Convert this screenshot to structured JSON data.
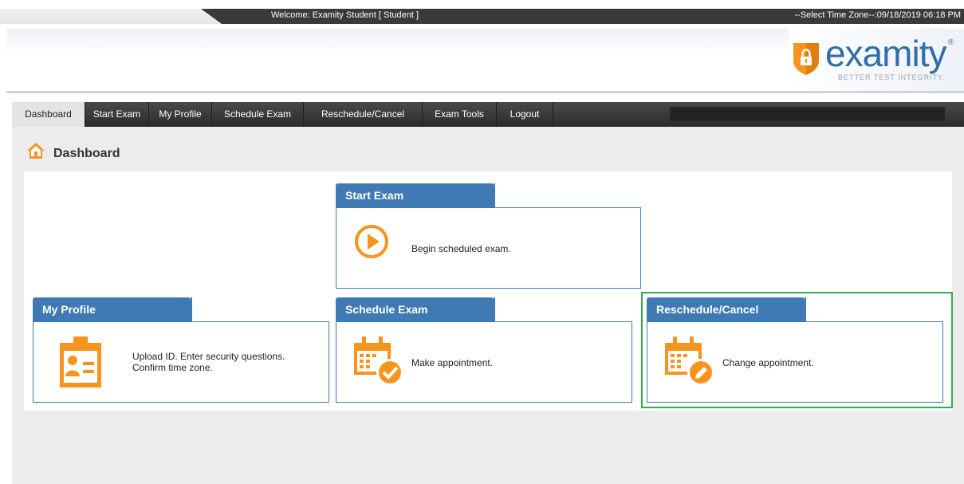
{
  "topbar": {
    "welcome": "Welcome: Examity Student [ Student ]",
    "timezone": "--Select Time Zone--:09/18/2019 06:18 PM"
  },
  "logo": {
    "word": "examity",
    "tagline": "BETTER TEST INTEGRITY."
  },
  "nav": {
    "items": [
      {
        "label": "Dashboard",
        "active": true
      },
      {
        "label": "Start Exam"
      },
      {
        "label": "My Profile"
      },
      {
        "label": "Schedule Exam"
      },
      {
        "label": "Reschedule/Cancel"
      },
      {
        "label": "Exam Tools"
      },
      {
        "label": "Logout"
      }
    ]
  },
  "dashboard": {
    "title": "Dashboard",
    "cards": {
      "start_exam": {
        "title": "Start Exam",
        "text": "Begin scheduled exam."
      },
      "my_profile": {
        "title": "My Profile",
        "text_line1": "Upload ID. Enter security questions.",
        "text_line2": "Confirm time zone."
      },
      "schedule_exam": {
        "title": "Schedule Exam",
        "text": "Make appointment."
      },
      "reschedule": {
        "title": "Reschedule/Cancel",
        "text": "Change appointment."
      }
    }
  },
  "colors": {
    "accent_blue": "#3f7ab4",
    "icon_orange": "#f7941d",
    "highlight_green": "#2fae4a"
  },
  "icons": [
    "home-icon",
    "play-icon",
    "id-card-icon",
    "calendar-check-icon",
    "calendar-edit-icon",
    "lock-shield-icon"
  ]
}
